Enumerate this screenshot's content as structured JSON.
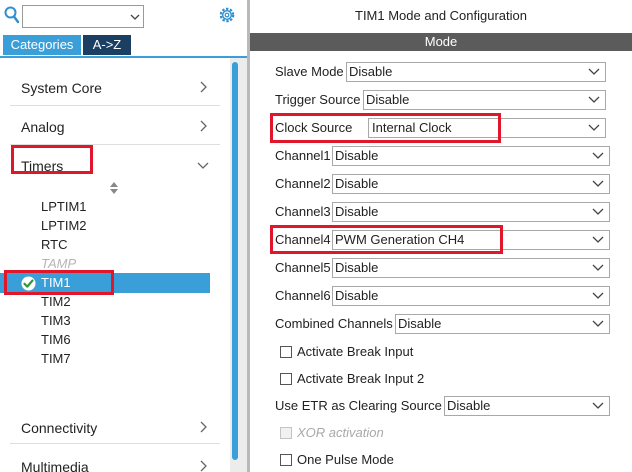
{
  "left_panel": {
    "search": {
      "value": "",
      "placeholder": ""
    },
    "tabs": [
      "Categories",
      "A->Z"
    ],
    "categories": [
      "System Core",
      "Analog",
      "Timers",
      "Connectivity",
      "Multimedia"
    ],
    "timers": [
      "LPTIM1",
      "LPTIM2",
      "RTC",
      "TAMP",
      "TIM1",
      "TIM2",
      "TIM3",
      "TIM6",
      "TIM7"
    ],
    "selected_timer": "TIM1",
    "disabled_timer": "TAMP"
  },
  "right_panel": {
    "title": "TIM1 Mode and Configuration",
    "section": "Mode",
    "fields": [
      {
        "label": "Slave Mode",
        "value": "Disable"
      },
      {
        "label": "Trigger Source",
        "value": "Disable"
      },
      {
        "label": "Clock Source",
        "value": "Internal Clock"
      },
      {
        "label": "Channel1",
        "value": "Disable"
      },
      {
        "label": "Channel2",
        "value": "Disable"
      },
      {
        "label": "Channel3",
        "value": "Disable"
      },
      {
        "label": "Channel4",
        "value": "PWM Generation CH4"
      },
      {
        "label": "Channel5",
        "value": "Disable"
      },
      {
        "label": "Channel6",
        "value": "Disable"
      },
      {
        "label": "Combined Channels",
        "value": "Disable"
      }
    ],
    "checkboxes": [
      {
        "label": "Activate Break Input",
        "checked": false,
        "enabled": true
      },
      {
        "label": "Activate Break Input 2",
        "checked": false,
        "enabled": true
      }
    ],
    "etr": {
      "label": "Use ETR as Clearing Source",
      "value": "Disable"
    },
    "checkboxes2": [
      {
        "label": "XOR activation",
        "checked": false,
        "enabled": false
      },
      {
        "label": "One Pulse Mode",
        "checked": false,
        "enabled": true
      }
    ]
  },
  "colors": {
    "accent": "#3a9fd8",
    "tab_dark": "#1b3f63",
    "section_bar": "#5b5b5b",
    "highlight_box": "#e0162b",
    "check_green": "#2e9a3b"
  }
}
